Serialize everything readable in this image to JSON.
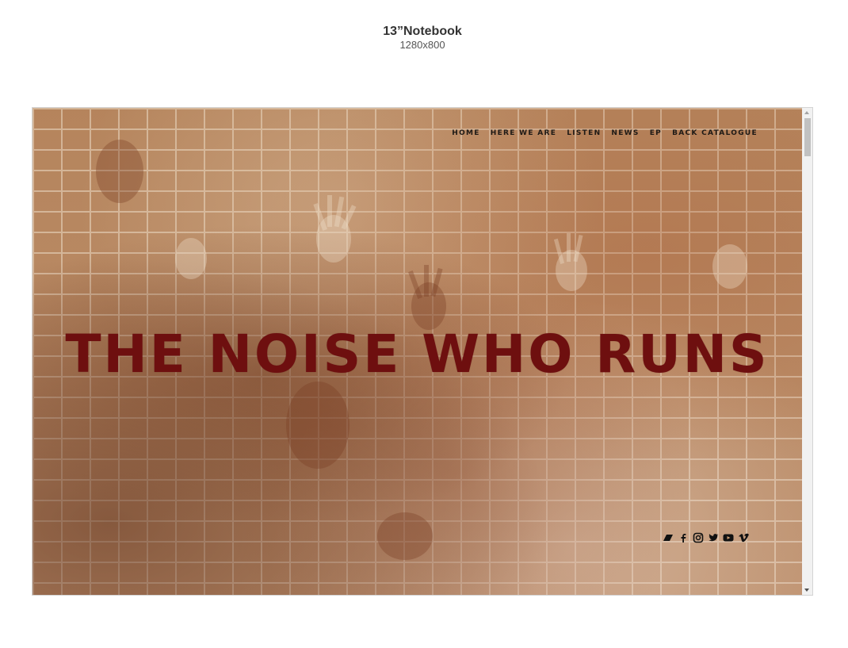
{
  "device": {
    "name": "13”Notebook",
    "resolution": "1280x800"
  },
  "site": {
    "title": "THE NOISE WHO RUNS",
    "nav": [
      "HOME",
      "HERE WE ARE",
      "LISTEN",
      "NEWS",
      "EP",
      "BACK CATALOGUE"
    ],
    "social_icons": [
      "bandcamp-icon",
      "facebook-icon",
      "instagram-icon",
      "twitter-icon",
      "youtube-icon",
      "vimeo-icon"
    ]
  },
  "colors": {
    "title": "#6e0f0f",
    "nav_text": "#1f1a16",
    "brick": "#b98a62"
  }
}
